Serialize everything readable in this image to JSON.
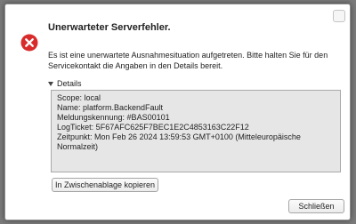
{
  "dialog": {
    "title": "Unerwarteter Serverfehler.",
    "message": "Es ist eine unerwartete Ausnahmesituation aufgetreten. Bitte halten Sie für den Servicekontakt die Angaben in den Details bereit.",
    "icon": "error-icon",
    "details_label": "Details",
    "details_lines": [
      "Scope: local",
      "Name: platform.BackendFault",
      "Meldungskennung: #BAS00101",
      "LogTicket: 5F67AFC625F7BEC1E2C4853163C22F12",
      "Zeitpunkt: Mon Feb 26 2024 13:59:53 GMT+0100 (Mitteleuropäische",
      "Normalzeit)"
    ],
    "copy_label": "In Zwischenablage kopieren",
    "close_label": "Schließen"
  },
  "colors": {
    "error_red": "#d92b2b",
    "backdrop": "#7a7a7a",
    "details_bg": "#e6e6e6"
  }
}
